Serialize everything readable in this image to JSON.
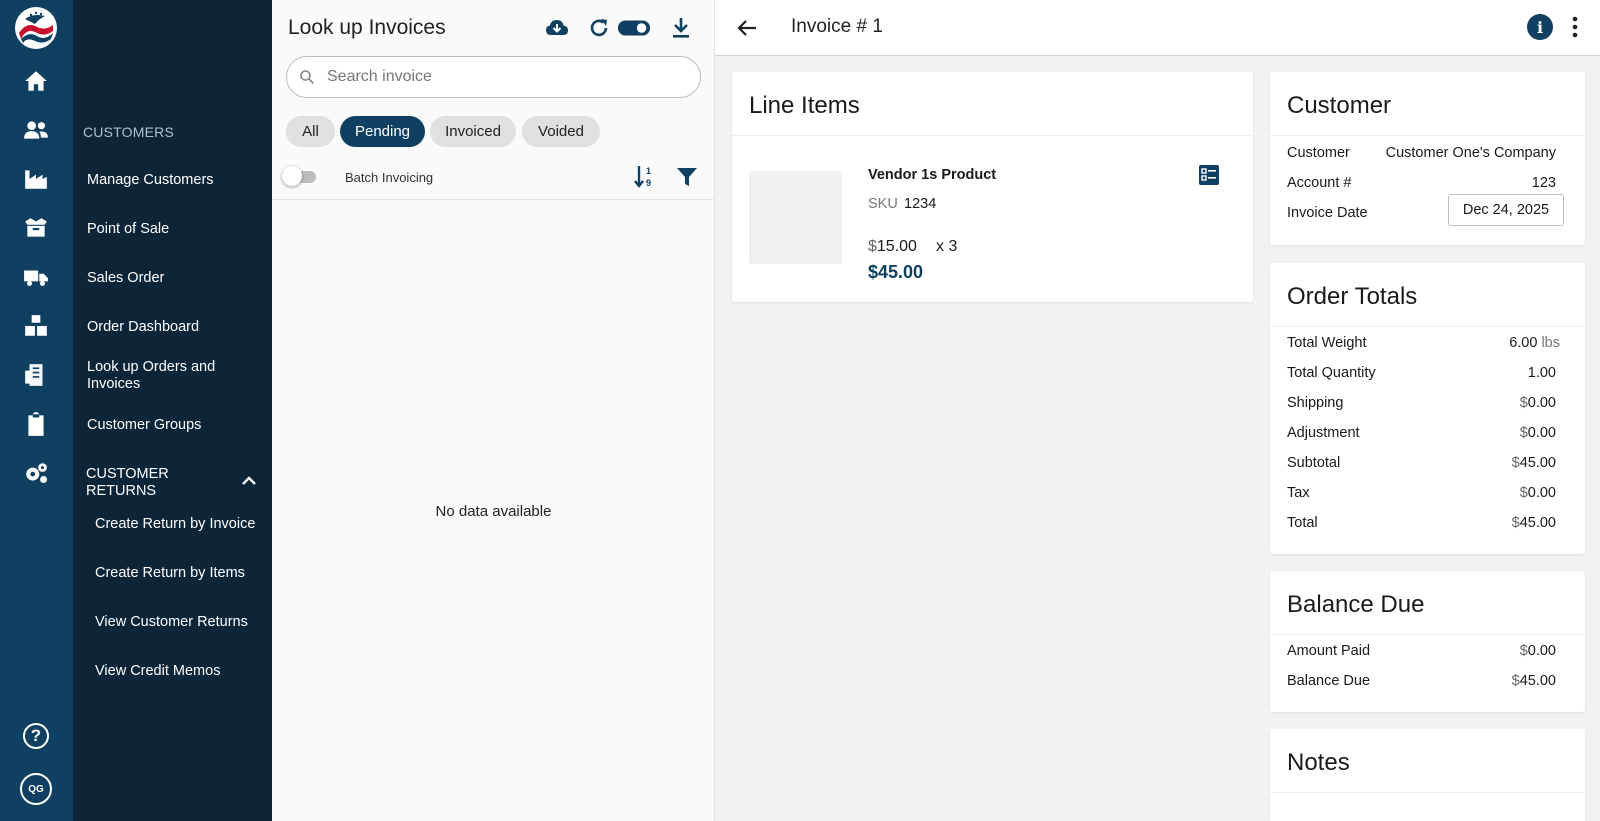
{
  "submenu": {
    "section": "CUSTOMERS",
    "items": [
      "Manage Customers",
      "Point of Sale",
      "Sales Order",
      "Order Dashboard",
      "Look up Orders and Invoices",
      "Customer Groups"
    ],
    "returns_header": "CUSTOMER RETURNS",
    "return_items": [
      "Create Return by Invoice",
      "Create Return by Items",
      "View Customer Returns",
      "View Credit Memos"
    ]
  },
  "rail": {
    "help": "?",
    "avatar_initials": "QG"
  },
  "list": {
    "title": "Look up Invoices",
    "search_placeholder": "Search invoice",
    "chips": [
      "All",
      "Pending",
      "Invoiced",
      "Voided"
    ],
    "active_chip": "Pending",
    "batch_label": "Batch Invoicing",
    "empty_text": "No data available"
  },
  "detail": {
    "title": "Invoice # 1",
    "line_items": {
      "title": "Line Items",
      "product_name": "Vendor 1s Product",
      "sku_label": "SKU",
      "sku": "1234",
      "currency": "$",
      "unit_price": "15.00",
      "qty_text": "x 3",
      "line_total": "$45.00"
    },
    "customer": {
      "title": "Customer",
      "customer_label": "Customer",
      "customer_value": "Customer One's Company",
      "account_label": "Account #",
      "account_value": "123",
      "date_label": "Invoice Date",
      "date_value": "Dec 24, 2025"
    },
    "totals": {
      "title": "Order Totals",
      "weight_label": "Total Weight",
      "weight_value": "6.00",
      "weight_unit": "lbs",
      "quantity_label": "Total Quantity",
      "quantity_value": "1.00",
      "shipping_label": "Shipping",
      "shipping_value": "0.00",
      "adjustment_label": "Adjustment",
      "adjustment_value": "0.00",
      "subtotal_label": "Subtotal",
      "subtotal_value": "45.00",
      "tax_label": "Tax",
      "tax_value": "0.00",
      "total_label": "Total",
      "total_value": "45.00"
    },
    "balance": {
      "title": "Balance Due",
      "paid_label": "Amount Paid",
      "paid_value": "0.00",
      "due_label": "Balance Due",
      "due_value": "45.00"
    },
    "notes": {
      "title": "Notes"
    }
  },
  "colors": {
    "rail": "#0f3f61",
    "submenu": "#0c2538",
    "accent": "#0f3f61"
  },
  "icons": [
    "home-icon",
    "customers-icon",
    "factory-icon",
    "box-icon",
    "truck-icon",
    "warehouse-icon",
    "invoice-icon",
    "clipboard-icon",
    "settings-icon",
    "help-icon",
    "cloud-download-icon",
    "refresh-icon",
    "toggle-icon",
    "download-icon",
    "search-icon",
    "sort-icon",
    "filter-icon",
    "back-arrow-icon",
    "info-icon",
    "more-vert-icon",
    "details-icon"
  ]
}
